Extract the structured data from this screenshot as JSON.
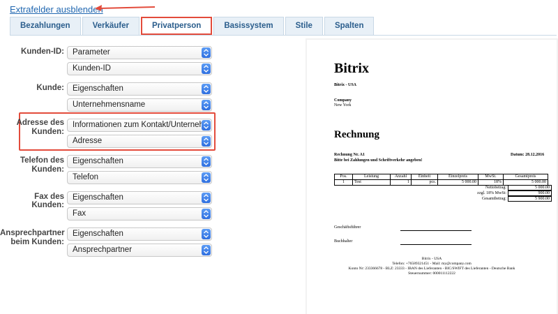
{
  "top_link": "Extrafelder ausblenden",
  "tabs": [
    "Bezahlungen",
    "Verkäufer",
    "Privatperson",
    "Basissystem",
    "Stile",
    "Spalten"
  ],
  "active_tab": "Privatperson",
  "form": [
    {
      "label": "Kunden-ID:",
      "selects": [
        "Parameter",
        "Kunden-ID"
      ]
    },
    {
      "label": "Kunde:",
      "selects": [
        "Eigenschaften",
        "Unternehmensname"
      ]
    },
    {
      "label": "Adresse des Kunden:",
      "selects": [
        "Informationen zum Kontakt/Unternehmen",
        "Adresse"
      ]
    },
    {
      "label": "Telefon des Kunden:",
      "selects": [
        "Eigenschaften",
        "Telefon"
      ]
    },
    {
      "label": "Fax des Kunden:",
      "selects": [
        "Eigenschaften",
        "Fax"
      ]
    },
    {
      "label": "Ansprechpartner beim Kunden:",
      "selects": [
        "Eigenschaften",
        "Ansprechpartner"
      ]
    }
  ],
  "document": {
    "company": "Bitrix",
    "company_sub": "Bitrix - USA",
    "customer_label": "Company",
    "customer_city": "New York",
    "heading": "Rechnung",
    "invoice_no": "Rechnung Nr. A1",
    "date": "Datum: 28.12.2016",
    "note": "Bitte bei Zahlungen und Schriftverkehr angeben!",
    "table_headers": [
      "Pos.",
      "Leistung",
      "Anzahl",
      "Einheit",
      "Einzelpreis",
      "MwSt.",
      "Gesamtpreis"
    ],
    "table_row": [
      "1",
      "Test",
      "1",
      "pcs.",
      "5 000.00",
      "18%",
      "5 000.00"
    ],
    "totals": [
      {
        "label": "Nettobetrag:",
        "value": "5 000.00"
      },
      {
        "label": "zzgl. 18% MwSt:",
        "value": "900.00"
      },
      {
        "label": "Gesamtbetrag:",
        "value": "5 900.00"
      }
    ],
    "sig1": "Geschäftsführer",
    "sig2": "Buchhalter",
    "footer1": "Bitrix - USA",
    "footer2": "Telefon: +76589321451 - Mail: my@company.com",
    "footer3": "Konto Nr: 233366678 - BLZ: 23333 - IBAN des Lieferanten - BIC/SWIFT des Lieferanten - Deutsche Bank",
    "footer4": "Steuernummer: 000011112222"
  },
  "colors": {
    "accent": "#2067b0",
    "highlight": "#e34b3b",
    "stepper": "#3b7be8"
  }
}
